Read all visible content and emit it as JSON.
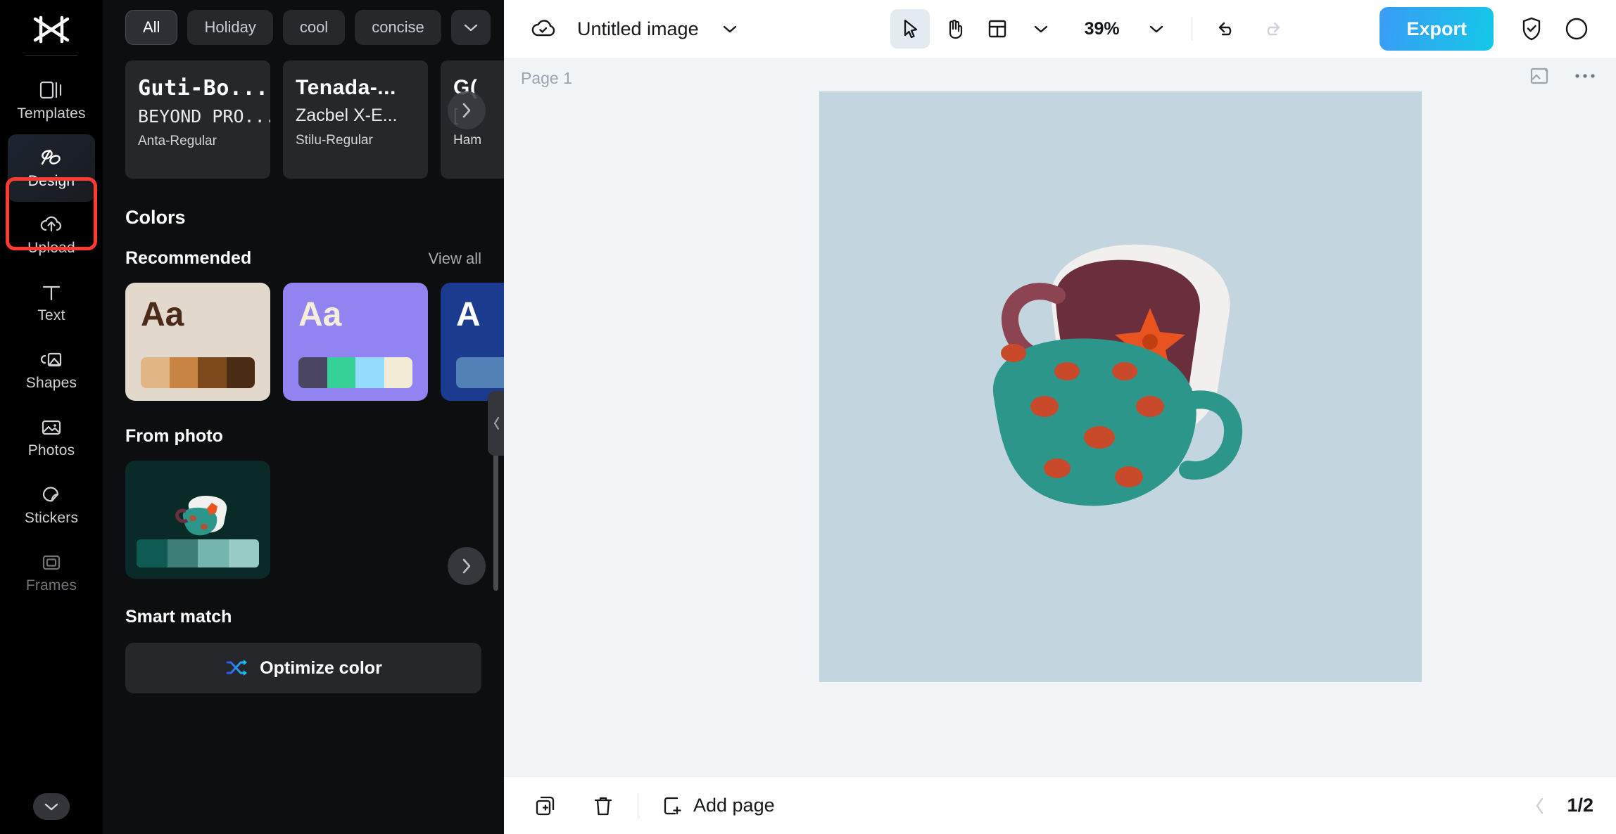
{
  "sidebar": {
    "logo_icon": "capcut-logo-icon",
    "items": [
      {
        "label": "Templates",
        "icon": "templates-icon",
        "state": "normal"
      },
      {
        "label": "Design",
        "icon": "design-icon",
        "state": "active"
      },
      {
        "label": "Upload",
        "icon": "upload-cloud-icon",
        "state": "normal"
      },
      {
        "label": "Text",
        "icon": "text-icon",
        "state": "normal"
      },
      {
        "label": "Shapes",
        "icon": "shapes-icon",
        "state": "normal"
      },
      {
        "label": "Photos",
        "icon": "photos-icon",
        "state": "normal"
      },
      {
        "label": "Stickers",
        "icon": "stickers-icon",
        "state": "normal"
      },
      {
        "label": "Frames",
        "icon": "frames-icon",
        "state": "dim"
      }
    ],
    "more_icon": "chevron-down-icon",
    "highlight_color": "#ff3b30",
    "highlighted_item": "Design"
  },
  "panel": {
    "filters": [
      {
        "label": "All",
        "selected": true
      },
      {
        "label": "Holiday",
        "selected": false
      },
      {
        "label": "cool",
        "selected": false
      },
      {
        "label": "concise",
        "selected": false
      }
    ],
    "filters_more_icon": "chevron-down-icon",
    "font_cards": [
      {
        "line1": "Guti-Bo...",
        "line2": "BEYOND PRO...",
        "name": "Anta-Regular"
      },
      {
        "line1": "Tenada-...",
        "line2": "Zacbel X-E...",
        "name": "Stilu-Regular"
      },
      {
        "line1": "G(",
        "line2": "[",
        "name": "Ham"
      }
    ],
    "fonts_next_icon": "chevron-right-icon",
    "colors_heading": "Colors",
    "recommended_label": "Recommended",
    "view_all_label": "View all",
    "colors_next_icon": "chevron-right-icon",
    "palettes": [
      {
        "sample_text": "Aa",
        "bg": "#e3d8cc",
        "text_color": "#4a2b17",
        "swatches": [
          "#dfb684",
          "#c88443",
          "#7e4a1c",
          "#4a2c15"
        ]
      },
      {
        "sample_text": "Aa",
        "bg": "#9284f0",
        "text_color": "#f5efd9",
        "swatches": [
          "#4a4560",
          "#35d196",
          "#93dcfb",
          "#f2ecd6"
        ]
      },
      {
        "sample_text": "A",
        "bg": "#1b3b8f",
        "text_color": "#ffffff",
        "swatches": [
          "#5281b8",
          "#5281b8",
          "#5281b8",
          "#5281b8"
        ]
      }
    ],
    "from_photo_label": "From photo",
    "from_photo": {
      "bg": "#0a2a27",
      "swatches": [
        "#0f5a53",
        "#3d7e78",
        "#74b5ad",
        "#97ccc5"
      ]
    },
    "smart_match_label": "Smart match",
    "optimize_button_label": "Optimize color",
    "optimize_icon": "shuffle-icon",
    "collapse_icon": "chevron-left-icon"
  },
  "topbar": {
    "cloud_icon": "cloud-check-icon",
    "document_title": "Untitled image",
    "title_chevron_icon": "chevron-down-icon",
    "tools": [
      {
        "icon": "cursor-icon",
        "name": "select-tool",
        "active": true
      },
      {
        "icon": "hand-icon",
        "name": "pan-tool",
        "active": false
      }
    ],
    "layout_icon": "layout-grid-icon",
    "layout_chevron_icon": "chevron-down-icon",
    "zoom_level": "39%",
    "zoom_chevron_icon": "chevron-down-icon",
    "undo_icon": "undo-icon",
    "redo_icon": "redo-icon",
    "redo_disabled": true,
    "export_label": "Export",
    "export_gradient_from": "#3a9cf5",
    "export_gradient_to": "#14c8e8",
    "shield_icon": "shield-check-icon"
  },
  "canvas": {
    "page_label": "Page 1",
    "image_icon": "image-broken-icon",
    "more_icon": "more-horizontal-icon",
    "artboard_bg": "#c3d5de"
  },
  "bottombar": {
    "duplicate_icon": "duplicate-page-icon",
    "delete_icon": "trash-icon",
    "add_page_icon": "add-page-icon",
    "add_page_label": "Add page",
    "prev_icon": "chevron-left-icon",
    "page_indicator": "1/2"
  }
}
